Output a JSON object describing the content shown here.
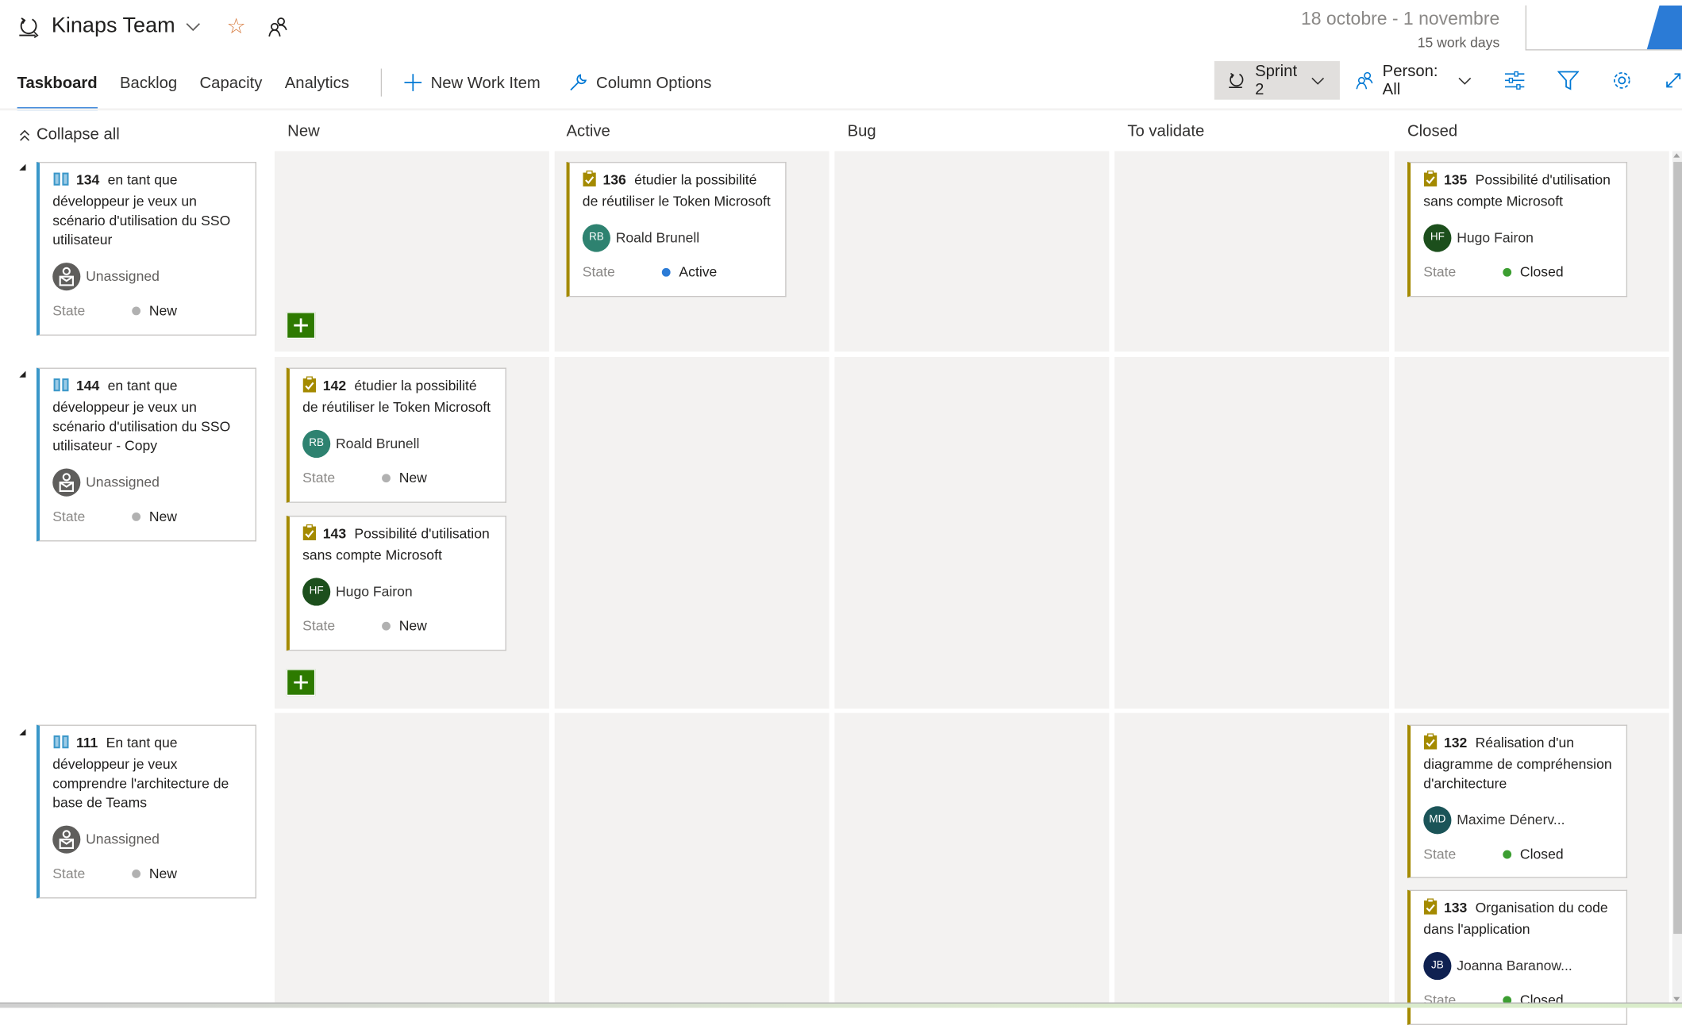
{
  "header": {
    "team_name": "Kinaps Team",
    "date_range": "18 octobre - 1 novembre",
    "work_days": "15 work days"
  },
  "tabs": [
    {
      "label": "Taskboard",
      "active": true
    },
    {
      "label": "Backlog",
      "active": false
    },
    {
      "label": "Capacity",
      "active": false
    },
    {
      "label": "Analytics",
      "active": false
    }
  ],
  "commands": {
    "new_work_item": "New Work Item",
    "column_options": "Column Options"
  },
  "toolbar": {
    "sprint": "Sprint 2",
    "person_filter": "Person: All"
  },
  "board": {
    "collapse_all": "Collapse all",
    "columns": [
      "New",
      "Active",
      "Bug",
      "To validate",
      "Closed"
    ],
    "state_label": "State",
    "colors": {
      "story_bar": "#3a97c9",
      "task_bar": "#a48a00",
      "state_new": "#b1b1b1",
      "state_active": "#2b7bd6",
      "state_closed": "#3c9e31",
      "add_button": "#2d7a00"
    },
    "rows": [
      {
        "parent": {
          "id": "134",
          "title": "en tant que développeur je veux un scénario d'utilisation du SSO utilisateur",
          "assignee": "Unassigned",
          "state": "New"
        },
        "tasks": [
          {
            "id": "136",
            "title": "étudier la possibilité de réutiliser le Token Microsoft",
            "assignee": "Roald Brunell",
            "initials": "RB",
            "avatar_color": "#2e8270",
            "state": "Active",
            "column": "Active"
          },
          {
            "id": "135",
            "title": "Possibilité d'utilisation sans compte Microsoft",
            "assignee": "Hugo Fairon",
            "initials": "HF",
            "avatar_color": "#1c4f1c",
            "state": "Closed",
            "column": "Closed"
          }
        ]
      },
      {
        "parent": {
          "id": "144",
          "title": "en tant que développeur je veux un scénario d'utilisation du SSO utilisateur  - Copy",
          "assignee": "Unassigned",
          "state": "New"
        },
        "tasks": [
          {
            "id": "142",
            "title": "étudier la possibilité de réutiliser le Token Microsoft",
            "assignee": "Roald Brunell",
            "initials": "RB",
            "avatar_color": "#2e8270",
            "state": "New",
            "column": "New"
          },
          {
            "id": "143",
            "title": "Possibilité d'utilisation sans compte Microsoft",
            "assignee": "Hugo Fairon",
            "initials": "HF",
            "avatar_color": "#1c4f1c",
            "state": "New",
            "column": "New"
          }
        ]
      },
      {
        "parent": {
          "id": "111",
          "title": "En tant que développeur je veux comprendre l'architecture de base de Teams",
          "assignee": "Unassigned",
          "state": "New"
        },
        "tasks": [
          {
            "id": "132",
            "title": "Réalisation d'un diagramme de compréhension d'architecture",
            "assignee": "Maxime Dénerv...",
            "initials": "MD",
            "avatar_color": "#1b5458",
            "state": "Closed",
            "column": "Closed"
          },
          {
            "id": "133",
            "title": "Organisation du code dans l'application",
            "assignee": "Joanna Baranow...",
            "initials": "JB",
            "avatar_color": "#0f2151",
            "state": "Closed",
            "column": "Closed"
          }
        ]
      }
    ]
  }
}
